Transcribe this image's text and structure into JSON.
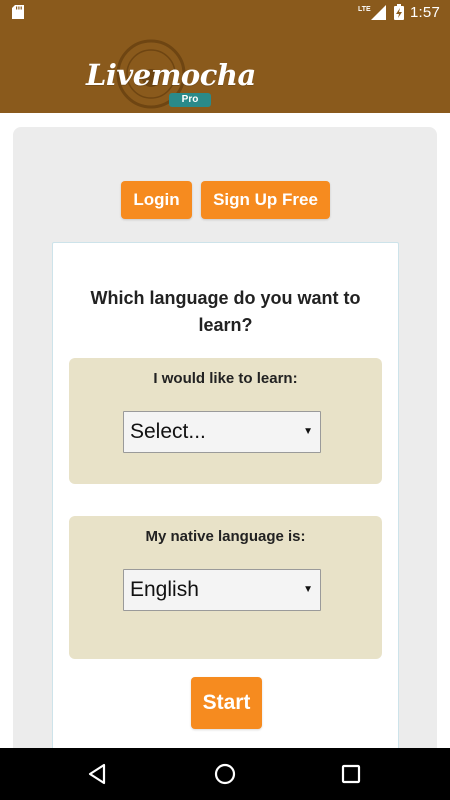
{
  "status_bar": {
    "network": "LTE",
    "time": "1:57"
  },
  "header": {
    "logo_text": "Livemocha",
    "logo_badge": "Pro",
    "brand_color": "#8a5a1c"
  },
  "auth": {
    "login_label": "Login",
    "signup_label": "Sign Up Free",
    "accent_color": "#f68b1f"
  },
  "form": {
    "question": "Which language do you want to learn?",
    "learn": {
      "label": "I would like to learn:",
      "selected": "Select..."
    },
    "native": {
      "label": "My native language is:",
      "selected": "English"
    },
    "start_label": "Start"
  },
  "nav": {
    "icons": [
      "back-icon",
      "home-icon",
      "recent-apps-icon"
    ]
  }
}
